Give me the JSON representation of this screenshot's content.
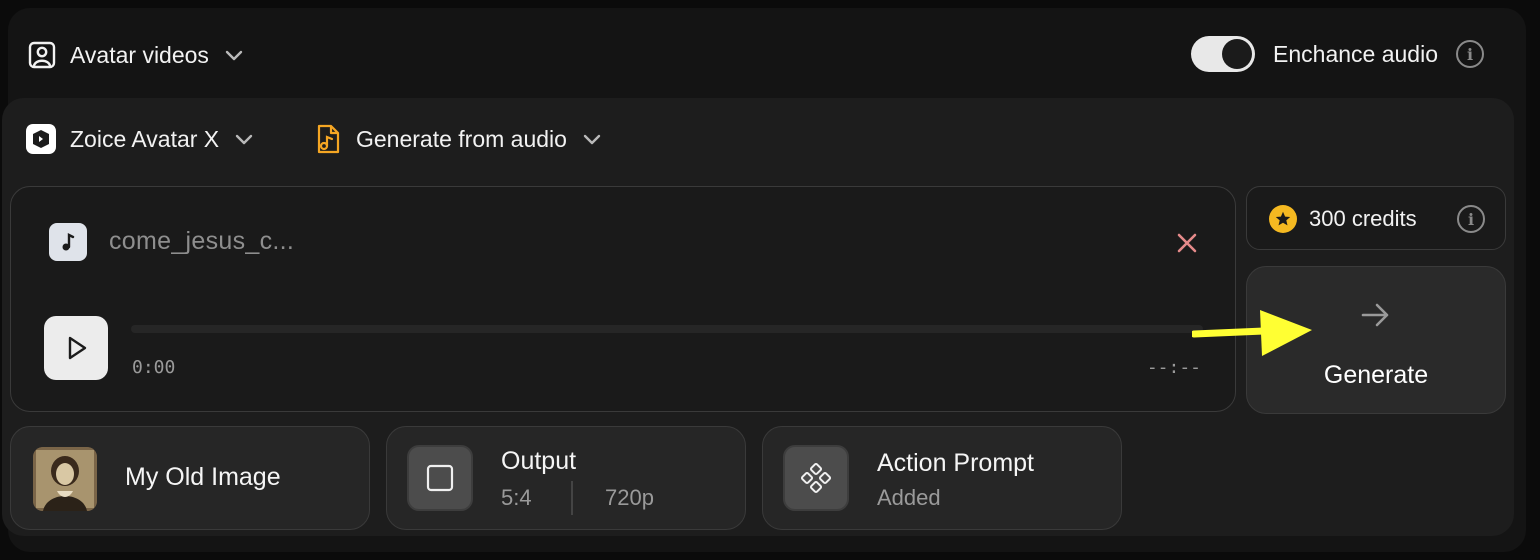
{
  "header": {
    "mode_label": "Avatar videos",
    "enhance_label": "Enchance audio",
    "enhance_on": true
  },
  "model": {
    "name": "Zoice Avatar X"
  },
  "source": {
    "label": "Generate from audio"
  },
  "audio": {
    "filename": "come_jesus_c...",
    "time_current": "0:00",
    "time_total": "--:--",
    "progress": 0
  },
  "credits": {
    "label": "300 credits"
  },
  "generate": {
    "label": "Generate"
  },
  "chips": {
    "image": {
      "title": "My Old Image"
    },
    "output": {
      "title": "Output",
      "ratio": "5:4",
      "resolution": "720p"
    },
    "action": {
      "title": "Action Prompt",
      "status": "Added"
    }
  },
  "colors": {
    "accent_orange": "#f5a623",
    "star": "#f5b921",
    "annotation_arrow": "#ffff33",
    "close": "#e58a8a"
  },
  "icons": [
    "user-square-icon",
    "chevron-down-icon",
    "info-icon",
    "zoice-logo-icon",
    "music-file-icon",
    "music-note-icon",
    "close-icon",
    "play-icon",
    "star-icon",
    "arrow-right-icon",
    "square-icon",
    "diamond-dots-icon"
  ]
}
